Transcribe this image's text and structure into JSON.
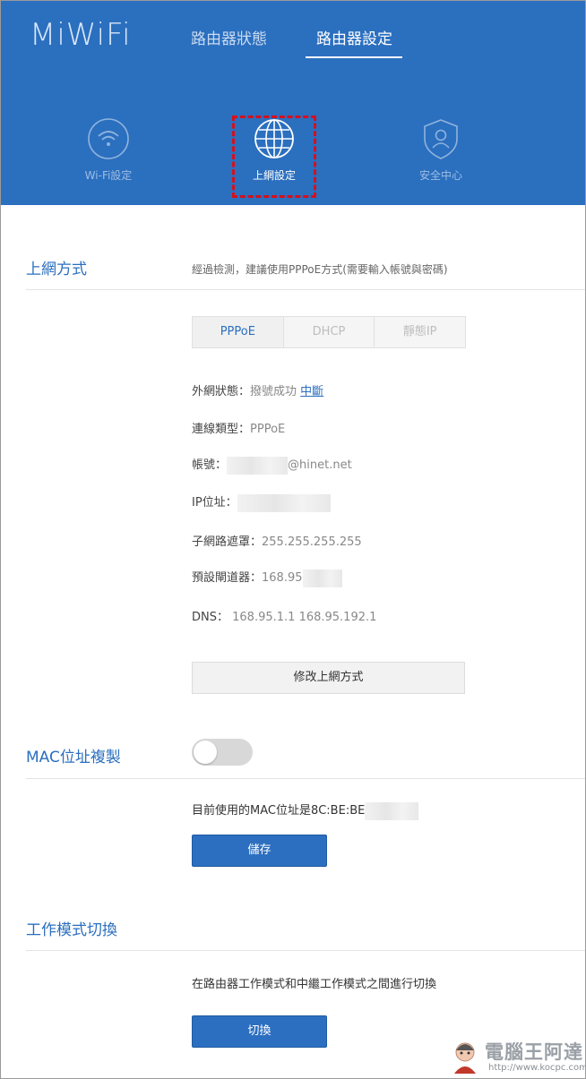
{
  "app": {
    "logo": "MiWiFi"
  },
  "topnav": {
    "status": "路由器狀態",
    "settings": "路由器設定"
  },
  "icons": {
    "wifi": "wifi-icon",
    "globe": "globe-icon",
    "shield": "shield-user-icon"
  },
  "subnav": [
    {
      "label": "Wi-Fi設定"
    },
    {
      "label": "上網設定"
    },
    {
      "label": "安全中心"
    }
  ],
  "internet": {
    "title": "上網方式",
    "hint": "經過檢測，建議使用PPPoE方式(需要輸入帳號與密碼)",
    "tabs": [
      "PPPoE",
      "DHCP",
      "靜態IP"
    ],
    "wan_status_label": "外網狀態：",
    "wan_status_value": "撥號成功",
    "disconnect_link": "中斷",
    "conn_type_label": "連線類型：",
    "conn_type_value": "PPPoE",
    "account_label": "帳號：",
    "account_suffix": "@hinet.net",
    "ip_label": "IP位址：",
    "subnet_label": "子網路遮罩：",
    "subnet_value": "255.255.255.255",
    "gateway_label": "預設閘道器：",
    "gateway_value": "168.95",
    "dns_label": "DNS：",
    "dns_value": "168.95.1.1 168.95.192.1",
    "modify_button": "修改上網方式"
  },
  "mac": {
    "title": "MAC位址複製",
    "toggle_on": false,
    "current_text": "目前使用的MAC位址是8C:BE:BE",
    "save_button": "儲存"
  },
  "mode": {
    "title": "工作模式切換",
    "desc": "在路由器工作模式和中繼工作模式之間進行切換",
    "switch_button": "切換"
  },
  "watermark": {
    "text": "電腦王阿達",
    "url": "http://www.kocpc.com.tw"
  },
  "colors": {
    "brand_blue": "#2b6fbf",
    "highlight_red": "#d6101c"
  }
}
